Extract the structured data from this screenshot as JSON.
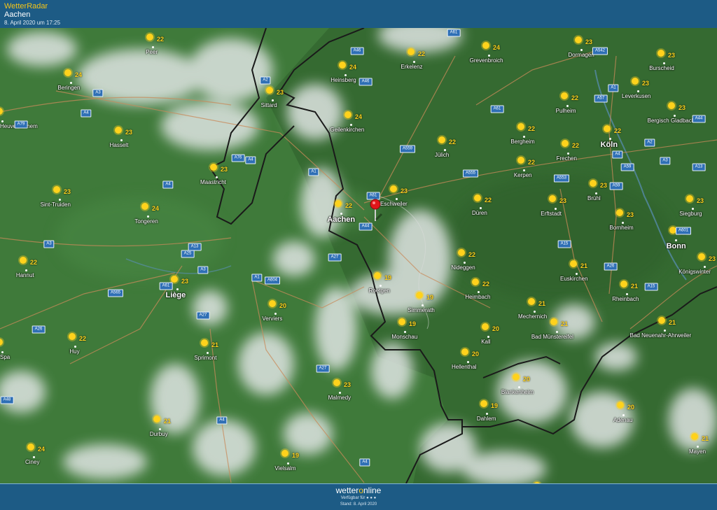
{
  "header": {
    "app_title": "WetterRadar",
    "location": "Aachen",
    "datetime": "8. April 2020 um 17:25"
  },
  "footer": {
    "brand_before": "wetter",
    "brand_o": "o",
    "brand_after": "nline",
    "available_for": "Verfügbar für",
    "status": "Stand: 8. April 2020"
  },
  "colors": {
    "header_bg": "#1d5b85",
    "title_accent": "#f5c518",
    "sun": "#ffd21c",
    "map_green": "#3f7a3a",
    "road_badge": "#2e6fb5",
    "pin": "#e0161a"
  },
  "pin": {
    "icon": "map-pin-icon",
    "color": "#e0161a"
  },
  "roads": [
    "A61",
    "A46",
    "A542",
    "A2",
    "A46",
    "A1",
    "A57",
    "A3",
    "A61",
    "A4",
    "A44",
    "A559",
    "A2",
    "A79",
    "A76",
    "A4",
    "A1",
    "A555",
    "A4",
    "A59",
    "A3",
    "A13",
    "A4",
    "A61",
    "A553",
    "A59",
    "A601",
    "A13",
    "A25",
    "A3",
    "A44",
    "A3",
    "A27",
    "A1",
    "A604",
    "A15",
    "A61",
    "A565",
    "A26",
    "A15",
    "A27",
    "A26",
    "A27",
    "A4",
    "A4",
    "A48"
  ],
  "cities": [
    {
      "name": "Peer",
      "temp": "22"
    },
    {
      "name": "Beringen",
      "temp": "24"
    },
    {
      "name": "Heinsberg",
      "temp": "24"
    },
    {
      "name": "Erkelenz",
      "temp": "22"
    },
    {
      "name": "Grevenbroich",
      "temp": "24"
    },
    {
      "name": "Dormagen",
      "temp": "23"
    },
    {
      "name": "Burscheid",
      "temp": "23"
    },
    {
      "name": "Sittard",
      "temp": "23"
    },
    {
      "name": "Leverkusen",
      "temp": "23"
    },
    {
      "name": "Pulheim",
      "temp": "22"
    },
    {
      "name": "Bergisch Gladbach",
      "temp": "23"
    },
    {
      "name": "Geilenkirchen",
      "temp": "24"
    },
    {
      "name": "Heuvel-Zichem",
      "temp": ""
    },
    {
      "name": "Hasselt",
      "temp": "23"
    },
    {
      "name": "Jülich",
      "temp": "22"
    },
    {
      "name": "Bergheim",
      "temp": "22"
    },
    {
      "name": "Köln",
      "temp": "22"
    },
    {
      "name": "Frechen",
      "temp": "22"
    },
    {
      "name": "Kerpen",
      "temp": "22"
    },
    {
      "name": "Maastricht",
      "temp": "23"
    },
    {
      "name": "Sint-Truiden",
      "temp": "23"
    },
    {
      "name": "Eschweiler",
      "temp": "23"
    },
    {
      "name": "Brühl",
      "temp": "23"
    },
    {
      "name": "Düren",
      "temp": "22"
    },
    {
      "name": "Erftstadt",
      "temp": "23"
    },
    {
      "name": "Siegburg",
      "temp": "23"
    },
    {
      "name": "Tongeren",
      "temp": "24"
    },
    {
      "name": "Aachen",
      "temp": "22"
    },
    {
      "name": "Bornheim",
      "temp": "23"
    },
    {
      "name": "Bonn",
      "temp": "23"
    },
    {
      "name": "Nideggen",
      "temp": "22"
    },
    {
      "name": "Königswinter",
      "temp": "23"
    },
    {
      "name": "Hannut",
      "temp": "22"
    },
    {
      "name": "Euskirchen",
      "temp": "21"
    },
    {
      "name": "Liège",
      "temp": "23"
    },
    {
      "name": "Roetgen",
      "temp": "19"
    },
    {
      "name": "Heimbach",
      "temp": "22"
    },
    {
      "name": "Rheinbach",
      "temp": "21"
    },
    {
      "name": "Verviers",
      "temp": "20"
    },
    {
      "name": "Simmerath",
      "temp": "19"
    },
    {
      "name": "Mechernich",
      "temp": "21"
    },
    {
      "name": "Bad Neuenahr-Ahrweiler",
      "temp": "21"
    },
    {
      "name": "Monschau",
      "temp": "19"
    },
    {
      "name": "Kall",
      "temp": "20"
    },
    {
      "name": "Bad Münstereifel",
      "temp": "21"
    },
    {
      "name": "Huy",
      "temp": "22"
    },
    {
      "name": "Spa",
      "temp": ""
    },
    {
      "name": "Sprimont",
      "temp": "21"
    },
    {
      "name": "Hellenthal",
      "temp": "20"
    },
    {
      "name": "Blankenheim",
      "temp": "20"
    },
    {
      "name": "Malmedy",
      "temp": "23"
    },
    {
      "name": "Dahlem",
      "temp": "19"
    },
    {
      "name": "Adenau",
      "temp": "20"
    },
    {
      "name": "Durbuy",
      "temp": "21"
    },
    {
      "name": "Ciney",
      "temp": "24"
    },
    {
      "name": "Vielsalm",
      "temp": "19"
    },
    {
      "name": "Mayen",
      "temp": "21"
    },
    {
      "name": "",
      "temp": "21"
    }
  ]
}
